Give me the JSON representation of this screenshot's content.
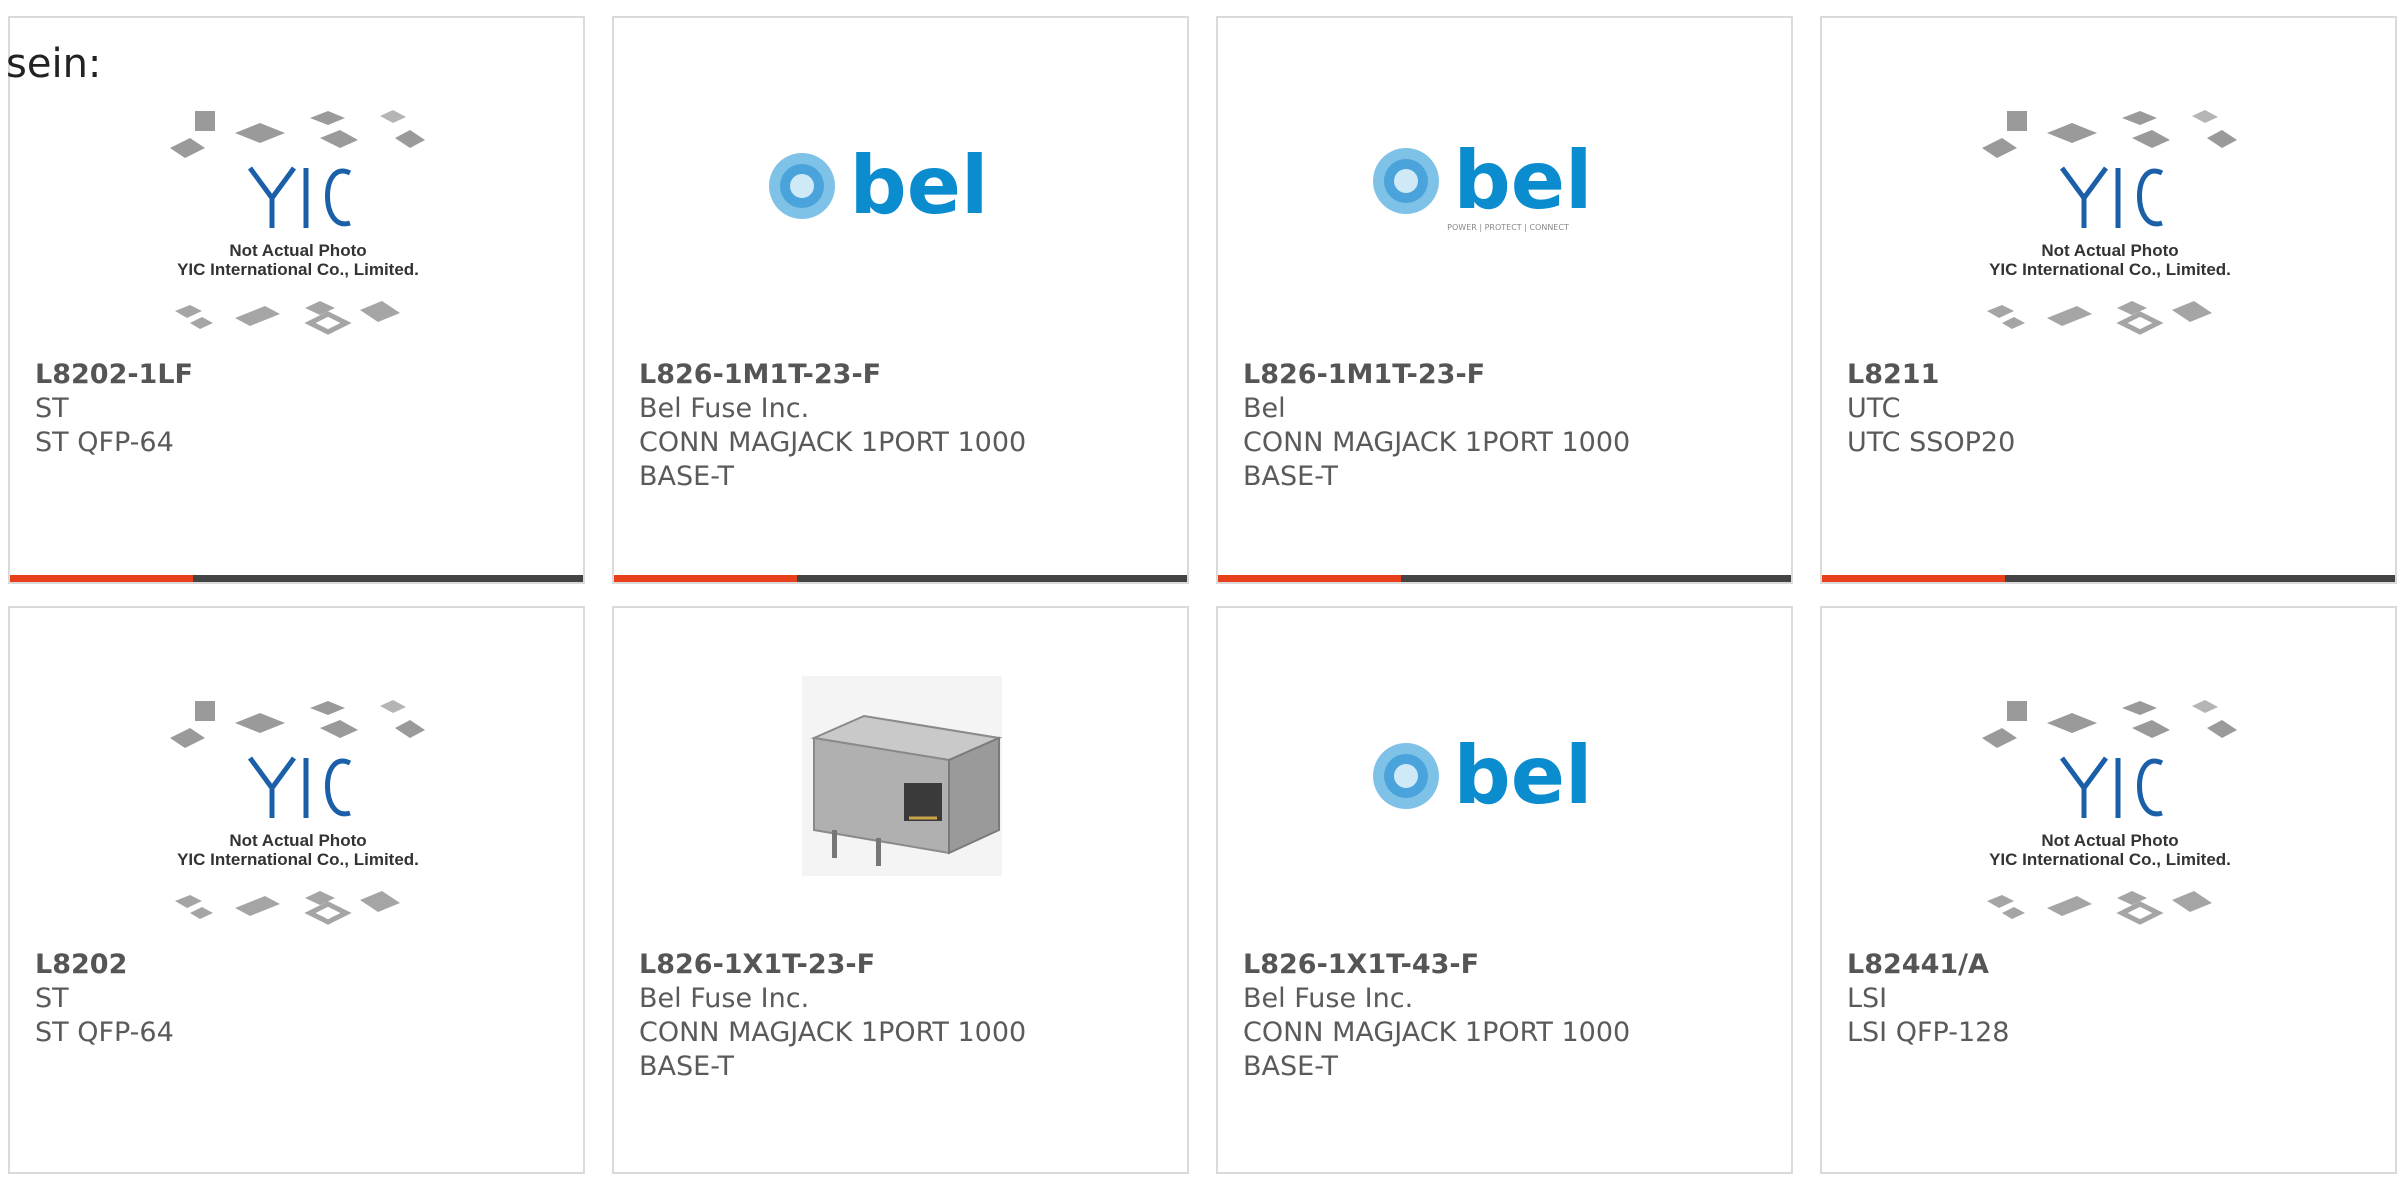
{
  "intro_text": "sein:",
  "colors": {
    "accent": "#e8401c",
    "bar": "#444444",
    "bel_blue": "#0a8ccf",
    "yic_blue": "#1a5fa8"
  },
  "placeholder_image": {
    "line1": "Not Actual Photo",
    "line2": "YIC International Co., Limited.",
    "logo_text": "YIC"
  },
  "bel_logo": {
    "text": "bel",
    "tagline": "POWER | PROTECT | CONNECT"
  },
  "products": [
    {
      "part_number": "L8202-1LF",
      "manufacturer": "ST",
      "desc_line1": "ST QFP-64",
      "desc_line2": "",
      "image": "yic-placeholder",
      "show_bar": true
    },
    {
      "part_number": "L826-1M1T-23-F",
      "manufacturer": "Bel Fuse Inc.",
      "desc_line1": "CONN MAGJACK 1PORT 1000",
      "desc_line2": "BASE-T",
      "image": "bel-logo",
      "show_bar": true
    },
    {
      "part_number": "L826-1M1T-23-F",
      "manufacturer": "Bel",
      "desc_line1": "CONN MAGJACK 1PORT 1000",
      "desc_line2": "BASE-T",
      "image": "bel-logo-tagline",
      "show_bar": true
    },
    {
      "part_number": "L8211",
      "manufacturer": "UTC",
      "desc_line1": "UTC SSOP20",
      "desc_line2": "",
      "image": "yic-placeholder",
      "show_bar": true
    },
    {
      "part_number": "L8202",
      "manufacturer": "ST",
      "desc_line1": "ST QFP-64",
      "desc_line2": "",
      "image": "yic-placeholder",
      "show_bar": false
    },
    {
      "part_number": "L826-1X1T-23-F",
      "manufacturer": "Bel Fuse Inc.",
      "desc_line1": "CONN MAGJACK 1PORT 1000",
      "desc_line2": "BASE-T",
      "image": "rj45-connector",
      "show_bar": false
    },
    {
      "part_number": "L826-1X1T-43-F",
      "manufacturer": "Bel Fuse Inc.",
      "desc_line1": "CONN MAGJACK 1PORT 1000",
      "desc_line2": "BASE-T",
      "image": "bel-logo",
      "show_bar": false
    },
    {
      "part_number": "L82441/A",
      "manufacturer": "LSI",
      "desc_line1": "LSI QFP-128",
      "desc_line2": "",
      "image": "yic-placeholder",
      "show_bar": false
    }
  ]
}
